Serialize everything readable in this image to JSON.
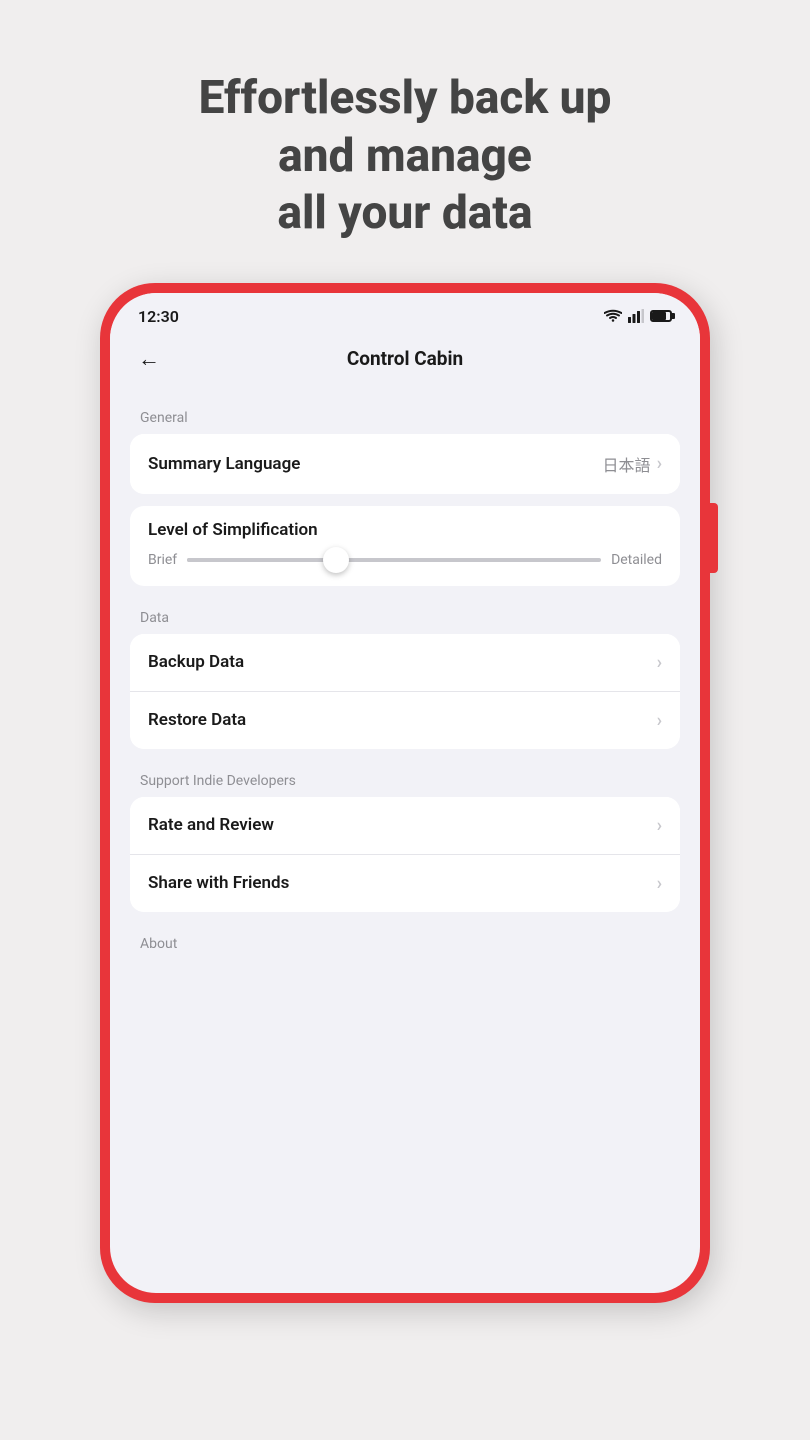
{
  "hero": {
    "title": "Effortlessly back up\nand manage\nall your data"
  },
  "phone": {
    "status_bar": {
      "time": "12:30"
    },
    "nav": {
      "title": "Control Cabin",
      "back_label": "←"
    },
    "sections": [
      {
        "id": "general",
        "label": "General",
        "rows": [
          {
            "id": "summary-language",
            "label": "Summary Language",
            "value": "日本語",
            "has_chevron": true
          }
        ]
      },
      {
        "id": "simplification",
        "label": "",
        "slider": {
          "title": "Level of Simplification",
          "left": "Brief",
          "right": "Detailed",
          "percent": 36
        }
      },
      {
        "id": "data",
        "label": "Data",
        "rows": [
          {
            "id": "backup-data",
            "label": "Backup Data",
            "value": "",
            "has_chevron": true
          },
          {
            "id": "restore-data",
            "label": "Restore Data",
            "value": "",
            "has_chevron": true
          }
        ]
      },
      {
        "id": "support",
        "label": "Support Indie Developers",
        "rows": [
          {
            "id": "rate-review",
            "label": "Rate and Review",
            "value": "",
            "has_chevron": true
          },
          {
            "id": "share-friends",
            "label": "Share with Friends",
            "value": "",
            "has_chevron": true
          }
        ]
      },
      {
        "id": "about",
        "label": "About",
        "rows": []
      }
    ]
  }
}
